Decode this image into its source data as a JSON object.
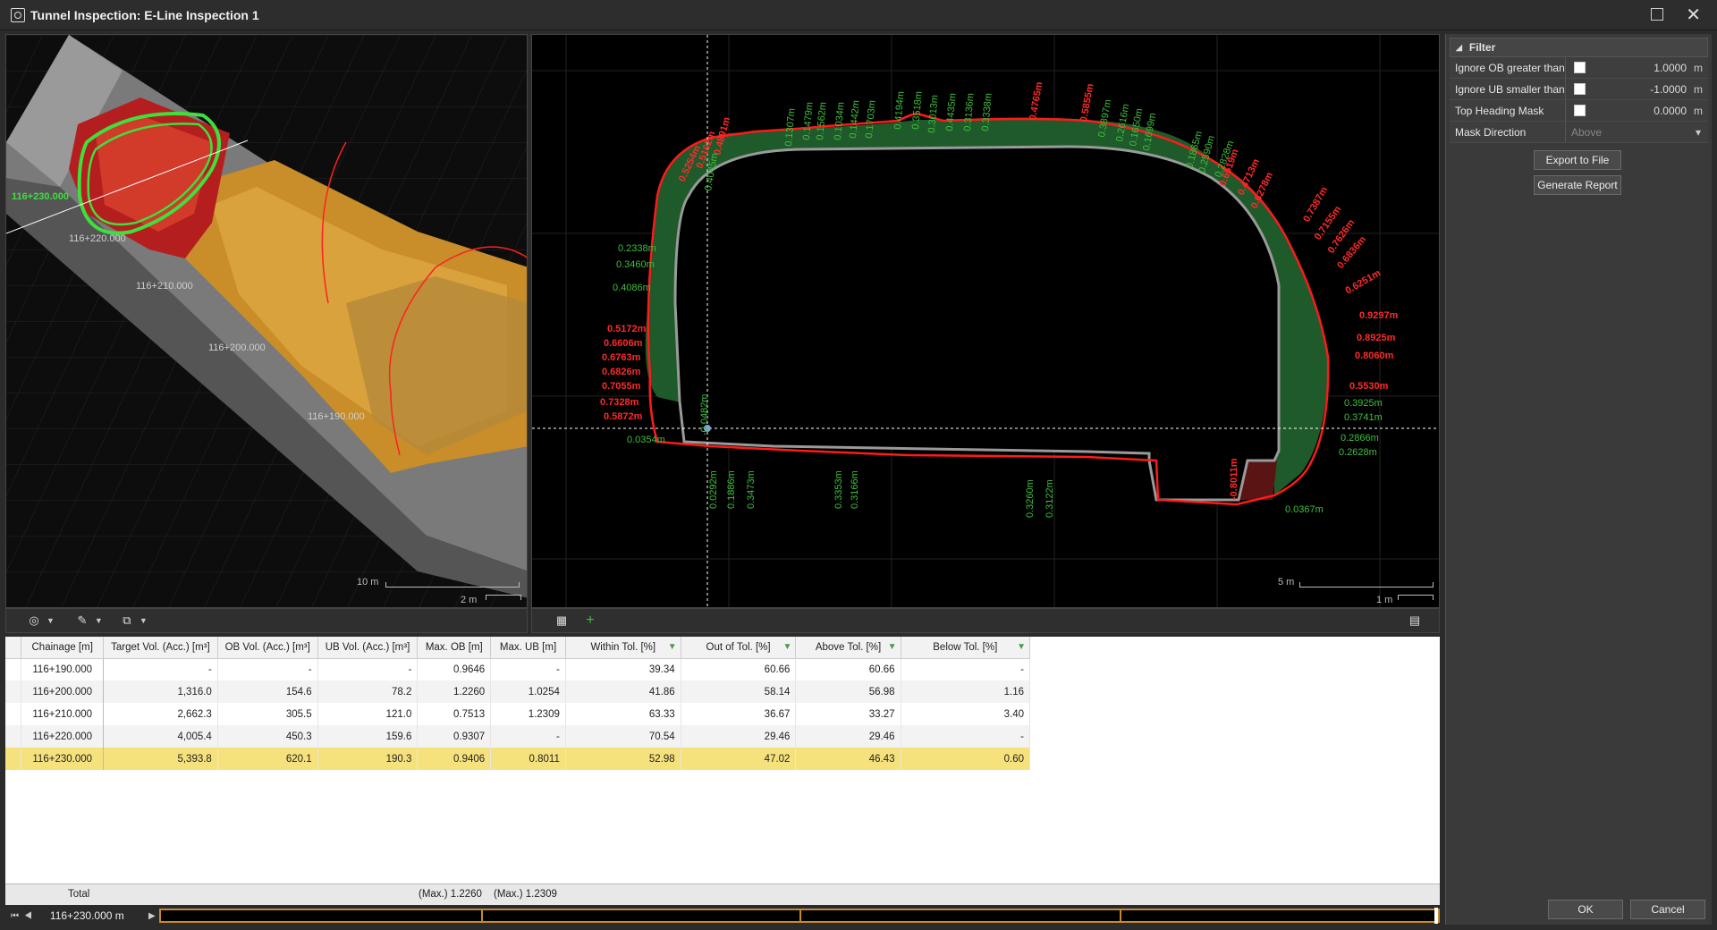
{
  "window": {
    "title": "Tunnel Inspection: E-Line Inspection 1"
  },
  "view3d": {
    "chainage_labels": [
      "116+230.000",
      "116+220.000",
      "116+210.000",
      "116+200.000",
      "116+190.000"
    ],
    "scale_major": "10 m",
    "scale_minor": "2 m"
  },
  "view2d": {
    "scale_major": "5 m",
    "scale_minor": "1 m",
    "labels_red": [
      "0.4891m",
      "0.5102m",
      "0.5254m",
      "0.4765m",
      "0.5855m",
      "0.6519m",
      "0.4713m",
      "0.6278m",
      "0.7387m",
      "0.7155m",
      "0.7626m",
      "0.6836m",
      "0.6251m",
      "0.9297m",
      "0.8925m",
      "0.8060m",
      "0.5530m",
      "0.5172m",
      "0.6606m",
      "0.6763m",
      "0.6826m",
      "0.7055m",
      "0.7328m",
      "0.5872m",
      "-0.8011m"
    ],
    "labels_green": [
      "0.4045m",
      "0.1307m",
      "0.1479m",
      "0.1562m",
      "0.1034m",
      "0.1442m",
      "0.1703m",
      "0.4194m",
      "0.3518m",
      "0.3013m",
      "0.4435m",
      "0.3136m",
      "0.3338m",
      "0.3897m",
      "0.2616m",
      "0.1650m",
      "0.1699m",
      "0.1865m",
      "0.2590m",
      "0.2828m",
      "0.2338m",
      "0.3460m",
      "0.4086m",
      "0.3925m",
      "0.3741m",
      "0.2866m",
      "0.2628m",
      "0.0354m",
      "-0.0482m",
      "0.0292m",
      "0.1886m",
      "0.3473m",
      "0.3353m",
      "0.3166m",
      "0.3260m",
      "0.3122m",
      "0.0367m"
    ]
  },
  "filter": {
    "header": "Filter",
    "rows": [
      {
        "label": "Ignore OB greater than",
        "value": "1.0000",
        "unit": "m"
      },
      {
        "label": "Ignore UB smaller than",
        "value": "-1.0000",
        "unit": "m"
      },
      {
        "label": "Top Heading Mask",
        "value": "0.0000",
        "unit": "m"
      }
    ],
    "mask_direction": {
      "label": "Mask Direction",
      "value": "Above"
    },
    "export_label": "Export to File",
    "report_label": "Generate Report"
  },
  "table": {
    "columns": [
      "Chainage [m]",
      "Target Vol. (Acc.) [m³]",
      "OB Vol. (Acc.) [m³]",
      "UB Vol. (Acc.) [m³]",
      "Max. OB [m]",
      "Max. UB [m]",
      "Within Tol. [%]",
      "Out of Tol. [%]",
      "Above Tol. [%]",
      "Below Tol. [%]"
    ],
    "rows": [
      [
        "116+190.000",
        "-",
        "-",
        "-",
        "0.9646",
        "-",
        "39.34",
        "60.66",
        "60.66",
        "-"
      ],
      [
        "116+200.000",
        "1,316.0",
        "154.6",
        "78.2",
        "1.2260",
        "1.0254",
        "41.86",
        "58.14",
        "56.98",
        "1.16"
      ],
      [
        "116+210.000",
        "2,662.3",
        "305.5",
        "121.0",
        "0.7513",
        "1.2309",
        "63.33",
        "36.67",
        "33.27",
        "3.40"
      ],
      [
        "116+220.000",
        "4,005.4",
        "450.3",
        "159.6",
        "0.9307",
        "-",
        "70.54",
        "29.46",
        "29.46",
        "-"
      ],
      [
        "116+230.000",
        "5,393.8",
        "620.1",
        "190.3",
        "0.9406",
        "0.8011",
        "52.98",
        "47.02",
        "46.43",
        "0.60"
      ]
    ],
    "footer": {
      "total": "Total",
      "max_ob": "(Max.) 1.2260",
      "max_ub": "(Max.) 1.2309"
    }
  },
  "navigator": {
    "chainage": "116+230.000  m"
  },
  "buttons": {
    "ok": "OK",
    "cancel": "Cancel"
  },
  "colors": {
    "over": "#e02020",
    "under_fill": "#1f5a2a",
    "selected_row": "#f6e27d",
    "accent_orange": "#c88a2e"
  }
}
